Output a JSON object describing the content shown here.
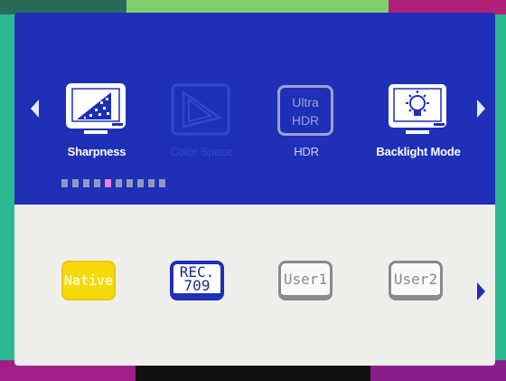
{
  "categories": [
    {
      "label": "Sharpness",
      "icon": "sharpness-monitor-icon",
      "state": "normal"
    },
    {
      "label": "Color Space",
      "icon": "color-space-icon",
      "state": "selected"
    },
    {
      "label": "HDR",
      "icon_text_1": "Ultra",
      "icon_text_2": "HDR",
      "state": "normal"
    },
    {
      "label": "Backlight Mode",
      "icon": "backlight-monitor-icon",
      "state": "normal"
    }
  ],
  "page_indicator": {
    "count": 10,
    "active_index": 4
  },
  "options": [
    {
      "label": "Native",
      "state": "selected"
    },
    {
      "label_1": "REC.",
      "label_2": "709",
      "state": "normal"
    },
    {
      "label": "User1",
      "state": "normal"
    },
    {
      "label": "User2",
      "state": "normal"
    }
  ],
  "colors": {
    "top_panel": "#1e2fb8",
    "bottom_panel": "#eeeeea",
    "active_dot": "#f080d8",
    "native_highlight": "#f5d90a"
  }
}
